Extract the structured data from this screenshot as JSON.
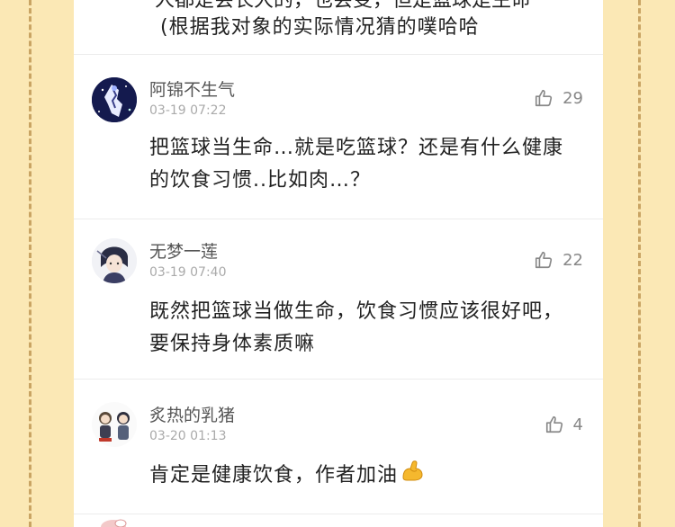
{
  "top_snippet": {
    "cut_line": "人都是会长大的，也会变，但是篮球是生命",
    "text": "(根据我对象的实际情况猜的噗哈哈"
  },
  "comments": [
    {
      "username": "阿锦不生气",
      "date": "03-19 07:22",
      "likes": "29",
      "text": "把篮球当生命…就是吃篮球？还是有什么健康的饮食习惯..比如肉…？",
      "avatar_icon": "galaxy-character-avatar"
    },
    {
      "username": "无梦一莲",
      "date": "03-19 07:40",
      "likes": "22",
      "text": "既然把篮球当做生命，饮食习惯应该很好吧，要保持身体素质嘛",
      "avatar_icon": "anime-character-avatar"
    },
    {
      "username": "炙热的乳猪",
      "date": "03-20 01:13",
      "likes": "4",
      "text": "肯定是健康饮食，作者加油",
      "emoji": "flexed-biceps-icon",
      "avatar_icon": "two-chibi-characters-avatar"
    }
  ],
  "colors": {
    "frame_background": "#fbe8b5",
    "frame_dash": "#c9a463",
    "panel": "#ffffff",
    "divider": "#ececec",
    "username": "#555555",
    "date": "#aaaaaa",
    "body_text": "#222222"
  }
}
